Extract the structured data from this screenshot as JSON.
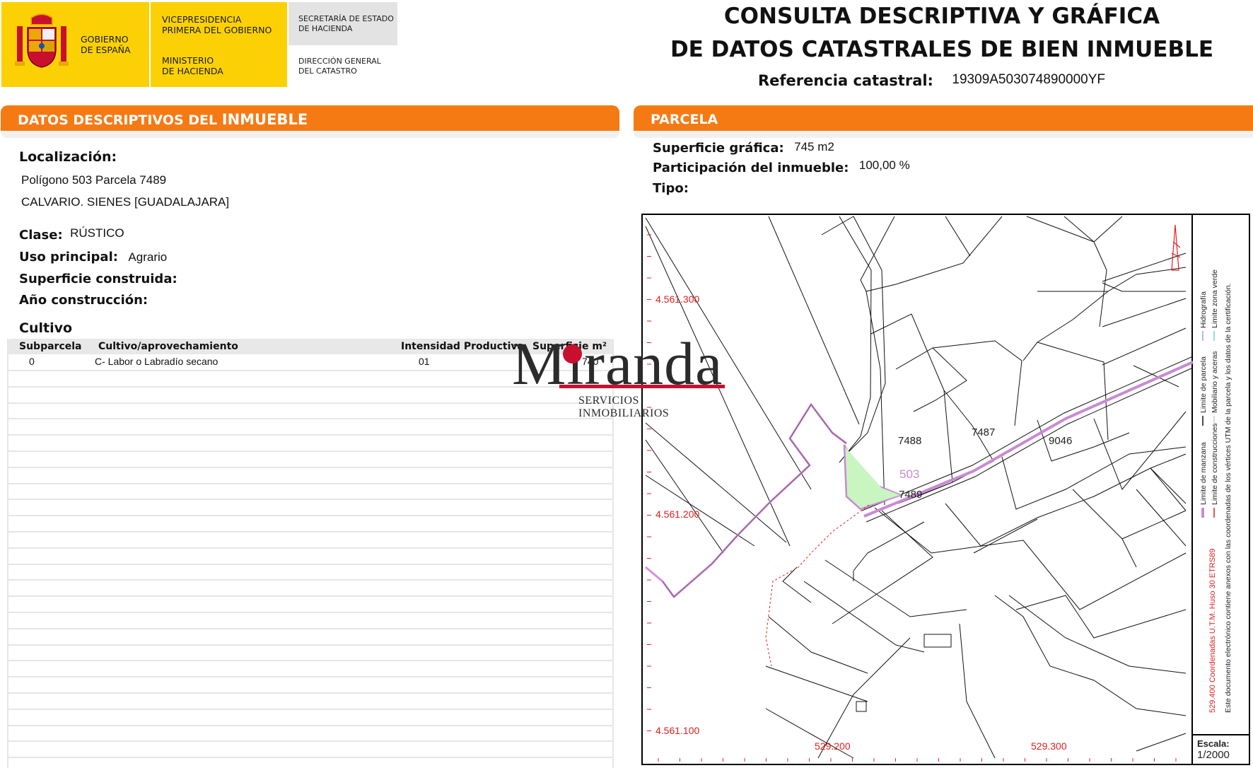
{
  "header": {
    "gobierno": [
      "GOBIERNO",
      "DE ESPAÑA"
    ],
    "vicepresidencia": [
      "VICEPRESIDENCIA",
      "PRIMERA DEL GOBIERNO"
    ],
    "ministerio": [
      "MINISTERIO",
      "DE HACIENDA"
    ],
    "secretaria": [
      "SECRETARÍA DE ESTADO",
      "DE HACIENDA"
    ],
    "direccion": [
      "DIRECCIÓN GENERAL",
      "DEL CATASTRO"
    ],
    "title_line1": "CONSULTA DESCRIPTIVA Y GRÁFICA",
    "title_line2": "DE DATOS CATASTRALES DE BIEN INMUEBLE",
    "ref_label": "Referencia catastral:",
    "ref_value": "19309A503074890000YF"
  },
  "datos": {
    "heading_a": "DATOS DESCRIPTIVOS DEL ",
    "heading_b": "INMUEBLE",
    "localizacion_label": "Localización:",
    "localizacion_line1": "Polígono 503 Parcela 7489",
    "localizacion_line2": "CALVARIO. SIENES [GUADALAJARA]",
    "clase_label": "Clase:",
    "clase_value": "RÚSTICO",
    "uso_label": "Uso principal:",
    "uso_value": "Agrario",
    "superficie_label": "Superficie construida:",
    "anio_label": "Año construcción:",
    "cultivo_title": "Cultivo",
    "table_headers": [
      "Subparcela",
      "Cultivo/aprovechamiento",
      "Intensidad Productiva",
      "Superficie m²"
    ],
    "rows": [
      {
        "subparcela": "0",
        "cultivo": "C- Labor o Labradío secano",
        "intensidad": "01",
        "superficie": "740"
      }
    ]
  },
  "parcela": {
    "heading": "PARCELA",
    "superficie_label": "Superficie gráfica:",
    "superficie_value": "745 m2",
    "participacion_label": "Participación del inmueble:",
    "participacion_value": "100,00 %",
    "tipo_label": "Tipo:"
  },
  "map": {
    "parcel_labels": [
      "7488",
      "7487",
      "9046",
      "503",
      "7489"
    ],
    "y_coords": [
      "4.561.300",
      "4.561.200",
      "4.561.100"
    ],
    "x_coords": [
      "529.200",
      "529.300"
    ],
    "legend": [
      "Limite de manzana",
      "Limite de construcciones",
      "Limite de parcela",
      "Mobiliario y aceras",
      "Hidrografía",
      "Limite zona verde"
    ],
    "coord_note": "529.400 Coordenadas U.T.M. Huso 30 ETRS89",
    "doc_note": "Este documento electrónico contiene anexos con las coordenadas de los vértices UTM de la parcela y los datos de la certificación.",
    "scale_label": "Escala:",
    "scale_value": "1/2000"
  },
  "watermark": {
    "name": "Miranda",
    "subtitle": "SERVICIOS INMOBILIARIOS"
  },
  "colors": {
    "orange": "#f57a14",
    "yellow": "#fbd106",
    "parcel_fill": "#c8f5c0",
    "boundary": "#d98ee0",
    "coord_red": "#e02020"
  }
}
